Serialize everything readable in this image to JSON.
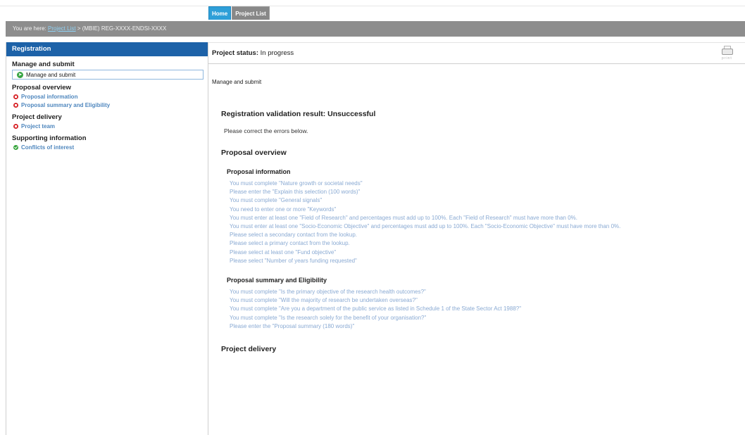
{
  "tabs": [
    {
      "label": "Home"
    },
    {
      "label": "Project List"
    }
  ],
  "breadcrumb": {
    "prefix": "You are here:",
    "link": "Project List",
    "separator": ">",
    "current": "(MBIE) REG-XXXX-ENDSI-XXXX"
  },
  "sidebar": {
    "header": "Registration",
    "groups": [
      {
        "title": "Manage and submit",
        "items": [
          {
            "label": "Manage and submit",
            "status": "current"
          }
        ]
      },
      {
        "title": "Proposal overview",
        "items": [
          {
            "label": "Proposal information",
            "status": "error"
          },
          {
            "label": "Proposal summary and Eligibility",
            "status": "error"
          }
        ]
      },
      {
        "title": "Project delivery",
        "items": [
          {
            "label": "Project team",
            "status": "error"
          }
        ]
      },
      {
        "title": "Supporting information",
        "items": [
          {
            "label": "Conflicts of interest",
            "status": "ok"
          }
        ]
      }
    ]
  },
  "status": {
    "label": "Project status:",
    "value": "In progress",
    "print_icon": "printer-icon",
    "print_text": "print"
  },
  "page_heading": "Manage and submit",
  "validation": {
    "title": "Registration validation result: Unsuccessful",
    "message": "Please correct the errors below.",
    "sections": [
      {
        "title": "Proposal overview",
        "subsections": [
          {
            "title": "Proposal information",
            "errors": [
              "You must complete \"Nature growth or societal needs\"",
              "Please enter the \"Explain this selection (100 words)\"",
              "You must complete \"General signals\"",
              "You need to enter one or more \"Keywords\"",
              "You must enter at least one \"Field of Research\" and percentages must add up to 100%. Each \"Field of Research\" must have more than 0%.",
              "You must enter at least one \"Socio-Economic Objective\" and percentages must add up to 100%. Each \"Socio-Economic Objective\" must have more than 0%.",
              "Please select a secondary contact from the lookup.",
              "Please select a primary contact from the lookup.",
              "Please select at least one \"Fund objective\"",
              "Please select \"Number of years funding requested\""
            ]
          },
          {
            "title": "Proposal summary and Eligibility",
            "errors": [
              "You must complete \"Is the primary objective of the research health outcomes?\"",
              "You must complete \"Will the majority of research be undertaken overseas?\"",
              "You must complete \"Are you a department of the public service as listed in Schedule 1 of the State Sector Act 1988?\"",
              "You must complete \"Is the research solely for the benefit of your organisation?\"",
              "Please enter the \"Proposal summary (180 words)\""
            ]
          }
        ]
      },
      {
        "title": "Project delivery",
        "subsections": []
      }
    ]
  },
  "colors": {
    "accent_blue": "#1d62a8",
    "tab_home": "#2e9fd8",
    "error_red": "#d8262a",
    "ok_green": "#36a43c",
    "error_link": "#8aaad3"
  }
}
